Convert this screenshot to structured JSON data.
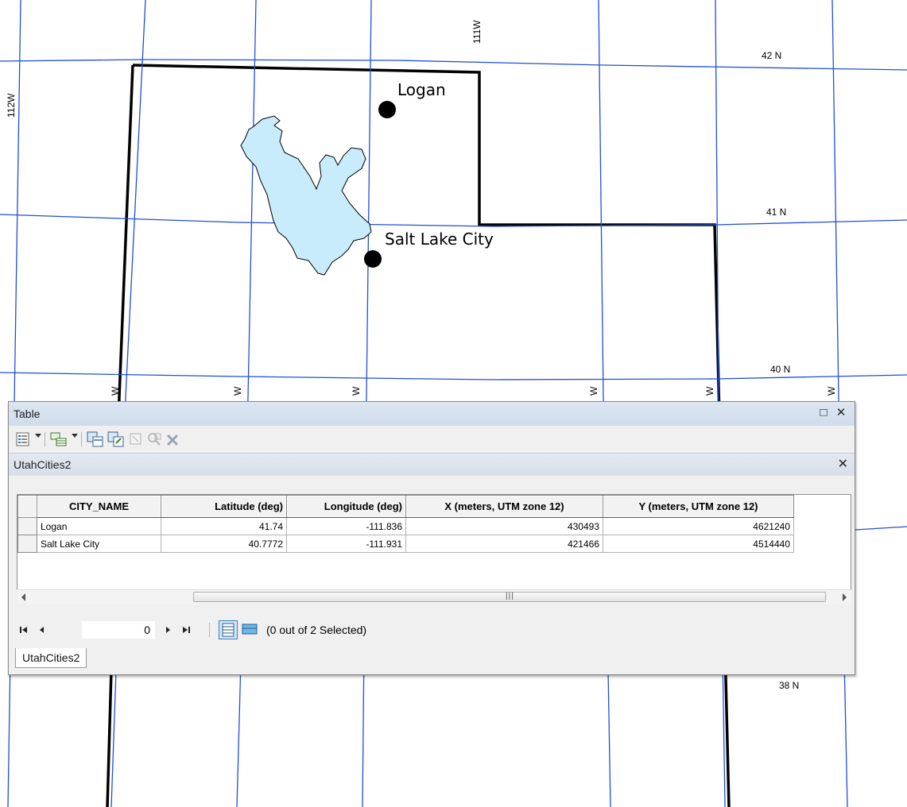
{
  "map": {
    "graticule_labels": {
      "lon_111w": "111W",
      "lon_112w": "112W",
      "lat_42n": "42 N",
      "lat_41n": "41 N",
      "lat_40n": "40 N",
      "lat_38n": "38 N",
      "w_ticks": [
        "W",
        "W",
        "W",
        "W",
        "W",
        "W"
      ]
    },
    "cities": [
      {
        "name": "Logan"
      },
      {
        "name": "Salt Lake City"
      }
    ],
    "colors": {
      "graticule": "#1f4fd6",
      "lake": "#c8ecfb",
      "border": "#000000"
    }
  },
  "table_window": {
    "title": "Table",
    "toolbar_icons": [
      "table-options-icon",
      "related-tables-icon",
      "select-by-attributes-icon",
      "switch-selection-icon",
      "clear-selection-icon",
      "zoom-to-selected-icon",
      "delete-selected-icon"
    ],
    "layer_tab_title": "UtahCities2",
    "columns": [
      "CITY_NAME",
      "Latitude (deg)",
      "Longitude (deg)",
      "X (meters, UTM zone 12)",
      "Y (meters, UTM zone 12)"
    ],
    "rows": [
      [
        "Logan",
        "41.74",
        "-111.836",
        "430493",
        "4621240"
      ],
      [
        "Salt Lake City",
        "40.7772",
        "-111.931",
        "421466",
        "4514440"
      ]
    ],
    "record_number": "0",
    "selection_status": "(0 out of 2 Selected)",
    "bottom_tab": "UtahCities2"
  }
}
